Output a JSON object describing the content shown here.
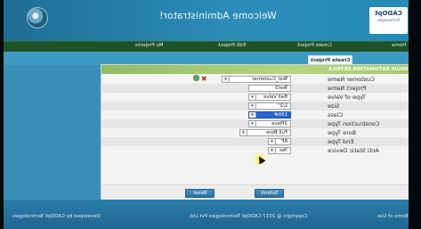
{
  "header": {
    "welcome_text": "Welcome Administrator!",
    "logo": {
      "name": "CADOpt",
      "tagline": "Technologies"
    },
    "accent_color": "#2c8db8"
  },
  "menu": {
    "items": [
      {
        "label": "Home"
      },
      {
        "label": "Create Project"
      },
      {
        "label": "Edit Project"
      },
      {
        "label": "My Projects"
      }
    ]
  },
  "tabs": {
    "active": "Create Project"
  },
  "form": {
    "section_title": "VALVE AUTOMATION DETAILS",
    "rows": [
      {
        "label": "Customer Name",
        "value": "Test_Customer",
        "kind": "select"
      },
      {
        "label": "Project Name",
        "value": "Test3",
        "kind": "text"
      },
      {
        "label": "Type of Valve",
        "value": "Ball Valve",
        "kind": "select"
      },
      {
        "label": "Size",
        "value": "1/2\"",
        "kind": "select"
      },
      {
        "label": "Class",
        "value": "150#",
        "kind": "select-highlight"
      },
      {
        "label": "Construction Type",
        "value": "2Piece",
        "kind": "select"
      },
      {
        "label": "Bore Type",
        "value": "Full Bore",
        "kind": "select"
      },
      {
        "label": "End Type",
        "value": "RF",
        "kind": "select"
      },
      {
        "label": "Anti Static Device",
        "value": "Yes",
        "kind": "select"
      }
    ],
    "buttons": {
      "submit": "Submit",
      "reset": "Reset"
    }
  },
  "footer": {
    "developed_by": "Developed by CADOpt Technologies",
    "copyright": "Copyright @ 2017 CADOpt Technologies Pvt Ltd.",
    "terms": "Terms of Use"
  }
}
